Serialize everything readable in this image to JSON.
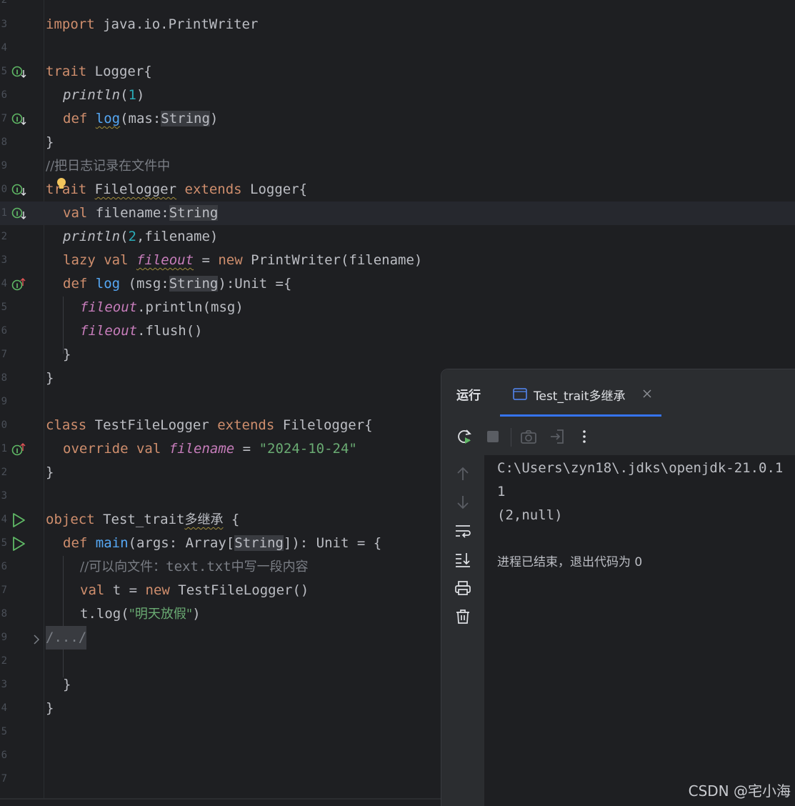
{
  "editor": {
    "line_numbers": [
      "2",
      "3",
      "4",
      "5",
      "6",
      "7",
      "8",
      "9",
      "0",
      "1",
      "2",
      "3",
      "4",
      "5",
      "6",
      "7",
      "8",
      "9",
      "0",
      "1",
      "2",
      "3",
      "4",
      "5",
      "6",
      "7",
      "8",
      "9",
      "2",
      "3",
      "4",
      "5",
      "6",
      "7"
    ],
    "lines": {
      "l1": [
        "import",
        " java.io.PrintWriter"
      ],
      "l3": [
        "trait",
        " Logger{"
      ],
      "l4": [
        "println",
        "(",
        "1",
        ")"
      ],
      "l5": [
        "def ",
        "log",
        "(mas:",
        "String",
        ")"
      ],
      "l6": [
        "}"
      ],
      "l7": [
        "//把日志记录在文件中"
      ],
      "l8": [
        "t",
        "rait",
        " ",
        "Filelogger",
        " ",
        "extends",
        " Logger{"
      ],
      "l9": [
        "val",
        " filename:",
        "String"
      ],
      "l10": [
        "println",
        "(",
        "2",
        ",filename)"
      ],
      "l11": [
        "lazy val ",
        "fileout",
        " = ",
        "new",
        " PrintWriter(filename)"
      ],
      "l12": [
        "def ",
        "log",
        " (msg:",
        "String",
        "):Unit ={"
      ],
      "l13": [
        "fileout",
        ".println(msg)"
      ],
      "l14": [
        "fileout",
        ".flush()"
      ],
      "l15": [
        "}"
      ],
      "l16": [
        "}"
      ],
      "l18": [
        "class",
        " TestFileLogger ",
        "extends",
        " Filelogger{"
      ],
      "l19": [
        "override val ",
        "filename",
        " = ",
        "\"2024-10-24\""
      ],
      "l20": [
        "}"
      ],
      "l22": [
        "object",
        " Test_trait",
        "多继承",
        " {"
      ],
      "l23": [
        "def ",
        "main",
        "(args: Array[",
        "String",
        "]): Unit = {"
      ],
      "l24": [
        "//可以向文件：",
        "text.txt",
        "中写一段内容"
      ],
      "l25": [
        "val",
        " t = ",
        "new",
        " TestFileLogger()"
      ],
      "l26": [
        "t.log(",
        "\"明天放假\"",
        ")"
      ],
      "l27": [
        "/.../"
      ],
      "l29": [
        "}"
      ],
      "l30": [
        "}"
      ]
    }
  },
  "run_panel": {
    "title": "运行",
    "tab_label": "Test_trait多继承",
    "console": [
      "C:\\Users\\zyn18\\.jdks\\openjdk-21.0.1",
      "1",
      "(2,null)",
      "",
      "进程已结束，退出代码为 0"
    ]
  },
  "watermark": "CSDN @宅小海",
  "colors": {
    "background": "#1e1f22",
    "keyword": "#cf8e6d",
    "string": "#6aab73",
    "number": "#2aacb8",
    "function": "#56a8f5",
    "field": "#c77dbb",
    "comment": "#7a7e85",
    "accent": "#3574f0"
  }
}
